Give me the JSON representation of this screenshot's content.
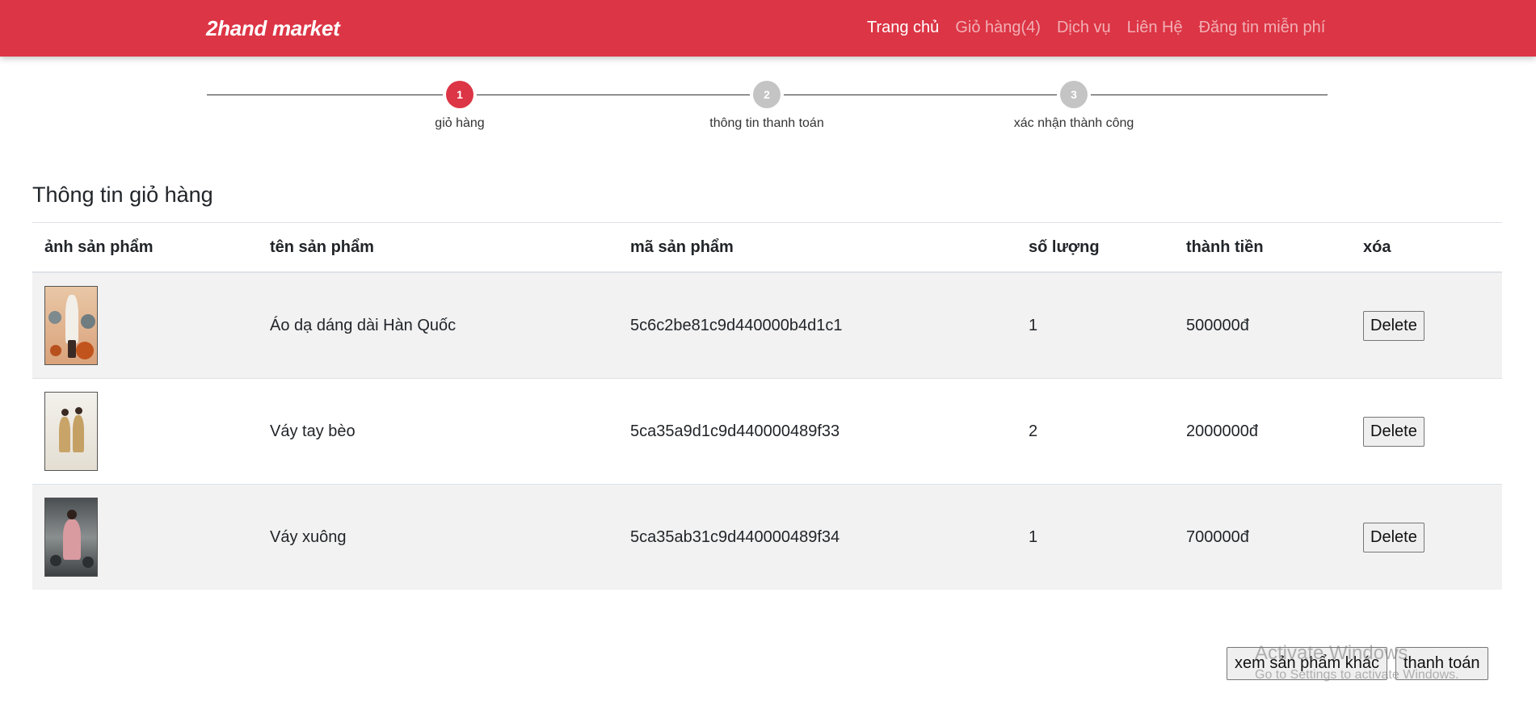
{
  "navbar": {
    "brand": "2hand market",
    "links": [
      {
        "label": "Trang chủ",
        "active": true
      },
      {
        "label": "Giỏ hàng(4)",
        "active": false
      },
      {
        "label": "Dịch vụ",
        "active": false
      },
      {
        "label": "Liên Hệ",
        "active": false
      },
      {
        "label": "Đăng tin miễn phí",
        "active": false
      }
    ]
  },
  "stepper": {
    "steps": [
      {
        "number": "1",
        "label": "giỏ hàng",
        "active": true
      },
      {
        "number": "2",
        "label": "thông tin thanh toán",
        "active": false
      },
      {
        "number": "3",
        "label": "xác nhận thành công",
        "active": false
      }
    ]
  },
  "cart": {
    "title": "Thông tin giỏ hàng",
    "columns": [
      "ảnh sản phẩm",
      "tên sản phẩm",
      "mã sản phẩm",
      "số lượng",
      "thành tiền",
      "xóa"
    ],
    "rows": [
      {
        "name": "Áo dạ dáng dài Hàn Quốc",
        "code": "5c6c2be81c9d440000b4d1c1",
        "quantity": "1",
        "total": "500000đ",
        "delete_label": "Delete"
      },
      {
        "name": "Váy tay bèo",
        "code": "5ca35a9d1c9d440000489f33",
        "quantity": "2",
        "total": "2000000đ",
        "delete_label": "Delete"
      },
      {
        "name": "Váy xuông",
        "code": "5ca35ab31c9d440000489f34",
        "quantity": "1",
        "total": "700000đ",
        "delete_label": "Delete"
      }
    ]
  },
  "actions": {
    "more_products": "xem sản phẩm khác",
    "checkout": "thanh toán"
  },
  "watermark": {
    "title": "Activate Windows",
    "subtitle": "Go to Settings to activate Windows."
  },
  "colors": {
    "brand_red": "#dc3545",
    "step_inactive": "#c4c4c4",
    "row_stripe": "#f2f2f2"
  }
}
